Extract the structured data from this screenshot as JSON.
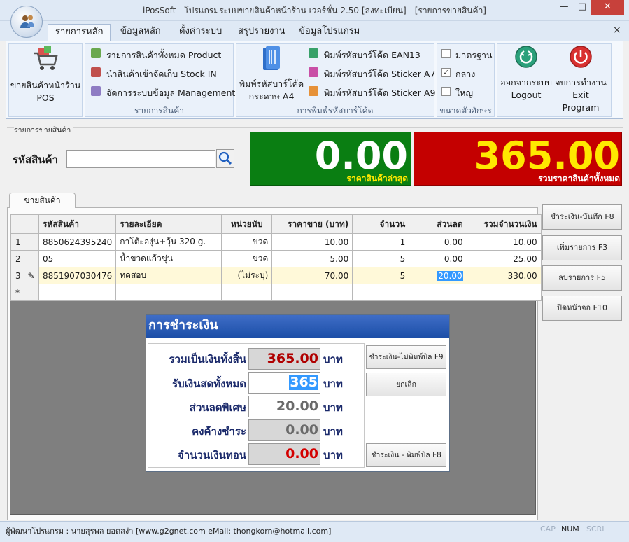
{
  "window": {
    "title": "iPosSoft - โปรแกรมระบบขายสินค้าหน้าร้าน เวอร์ชั่น 2.50 [ลงทะเบียน] - [รายการขายสินค้า]",
    "minimize": "—",
    "maximize": "□",
    "close": "✕"
  },
  "ribbon": {
    "tabs": [
      "รายการหลัก",
      "ข้อมูลหลัก",
      "ตั้งค่าระบบ",
      "สรุปรายงาน",
      "ข้อมูลโปรแกรม"
    ],
    "close_glyph": "×",
    "pos_button": {
      "line1": "ขายสินค้าหน้าร้าน",
      "line2": "POS"
    },
    "product_items": [
      "รายการสินค้าทั้งหมด Product",
      "นำสินค้าเข้าจัดเก็บ Stock IN",
      "จัดการระบบข้อมูล Management"
    ],
    "product_group_label": "รายการสินค้า",
    "barcode_a4": {
      "line1": "พิมพ์รหัสบาร์โค้ด",
      "line2": "กระดาษ A4"
    },
    "barcode_items": [
      "พิมพ์รหัสบาร์โค้ด EAN13",
      "พิมพ์รหัสบาร์โค้ด Sticker A7",
      "พิมพ์รหัสบาร์โค้ด Sticker A9"
    ],
    "barcode_group_label": "การพิมพ์รหัสบาร์โค้ด",
    "font_sizes": [
      {
        "label": "มาตรฐาน",
        "checked": false
      },
      {
        "label": "กลาง",
        "checked": true
      },
      {
        "label": "ใหญ่",
        "checked": false
      }
    ],
    "check_glyph": "✓",
    "font_group_label": "ขนาดตัวอักษร",
    "logout": {
      "line1": "ออกจากระบบ",
      "line2": "Logout"
    },
    "exit": {
      "line1": "จบการทำงาน",
      "line2": "Exit Program"
    }
  },
  "header": {
    "section_label": "รายการขายสินค้า",
    "code_label": "รหัสสินค้า",
    "code_value": "",
    "last_price": "0.00",
    "last_price_caption": "ราคาสินค้าล่าสุด",
    "total": "365.00",
    "total_caption": "รวมราคาสินค้าทั้งหมด"
  },
  "sale_tab": "ขายสินค้า",
  "grid": {
    "columns": [
      "รหัสสินค้า",
      "รายละเอียด",
      "หน่วยนับ",
      "ราคาขาย (บาท)",
      "จำนวน",
      "ส่วนลด",
      "รวมจำนวนเงิน"
    ],
    "rows": [
      {
        "num": "1",
        "code": "8850624395240",
        "desc": "กาโต้ะองุ่น+วุ้น 320 g.",
        "unit": "ขวด",
        "price": "10.00",
        "qty": "1",
        "discount": "0.00",
        "total": "10.00"
      },
      {
        "num": "2",
        "code": "05",
        "desc": "น้ำขวดแก้วขุ่น",
        "unit": "ขวด",
        "price": "5.00",
        "qty": "5",
        "discount": "0.00",
        "total": "25.00"
      },
      {
        "num": "3",
        "code": "8851907030476",
        "desc": "ทดสอบ",
        "unit": "(ไม่ระบุ)",
        "price": "70.00",
        "qty": "5",
        "discount": "20.00",
        "total": "330.00"
      }
    ],
    "new_row_marker": "*",
    "edit_marker": "✎"
  },
  "side_buttons": [
    "ชำระเงิน-บันทึก F8",
    "เพิ่มรายการ F3",
    "ลบรายการ F5",
    "ปิดหน้าจอ F10"
  ],
  "payment": {
    "title": "การชำระเงิน",
    "rows": [
      {
        "label": "รวมเป็นเงินทั้งสิ้น",
        "value": "365.00",
        "unit": "บาท"
      },
      {
        "label": "รับเงินสดทั้งหมด",
        "value": "365",
        "unit": "บาท"
      },
      {
        "label": "ส่วนลดพิเศษ",
        "value": "20.00",
        "unit": "บาท"
      },
      {
        "label": "คงค้างชำระ",
        "value": "0.00",
        "unit": "บาท"
      },
      {
        "label": "จำนวนเงินทอน",
        "value": "0.00",
        "unit": "บาท"
      }
    ],
    "buttons": [
      "ชำระเงิน-ไม่พิมพ์บิล F9",
      "ยกเลิก",
      "ชำระเงิน - พิมพ์บิล F8"
    ]
  },
  "status": {
    "text": "ผู้พัฒนาโปรแกรม : นายสุรพล ยอดสง่า [www.g2gnet.com  eMail: thongkorn@hotmail.com]",
    "cap": "CAP",
    "num": "NUM",
    "scrl": "SCRL"
  },
  "colors": {
    "accent": "#1c4fa8",
    "green_panel": "#0a7e12",
    "red_panel": "#c40000",
    "yellow_text": "#ffe800"
  }
}
